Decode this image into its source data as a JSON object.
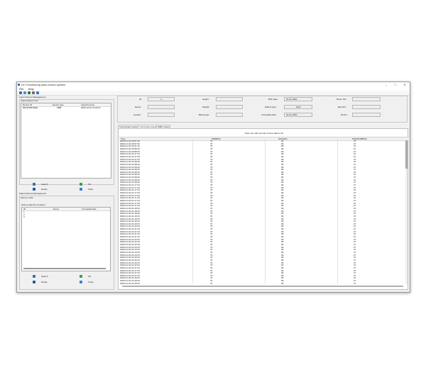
{
  "window": {
    "title": "DLT Monitoring data review system",
    "controls": {
      "minimize": "–",
      "maximize": "□",
      "close": "✕"
    }
  },
  "menu": [
    "File",
    "Help"
  ],
  "toolbar": {
    "icons": [
      "new-record-icon",
      "open-folder-icon",
      "save-icon",
      "print-icon",
      "settings-icon"
    ],
    "colors": [
      "#2d6fb5",
      "#4a90d9",
      "#2e7d32",
      "#6c6c6c",
      "#3a76c4"
    ]
  },
  "import_panel": {
    "title": "Import Record Management",
    "list_title": "Import Record List",
    "columns": [
      "Device ID",
      "Device type",
      "Importing time"
    ],
    "rows": [
      {
        "device_id": "8602345678901",
        "device_type": "M6B",
        "time": "2022-12-21 11:00:47"
      }
    ],
    "buttons": {
      "search": "Search",
      "fill": "Fill",
      "delete": "Delete",
      "clear": "Clear"
    }
  },
  "patient_panel": {
    "title": "Patient Record Management",
    "mode": "History mode",
    "list_title": "History data list of patient",
    "columns": [
      "ID",
      "Name",
      "In-hospital date"
    ],
    "rows": [
      "1",
      "2",
      "3"
    ],
    "buttons": {
      "search": "Search",
      "fill": "Fill",
      "delete": "Delete",
      "clear": "Close"
    }
  },
  "patient_info": {
    "id_label": "ID:",
    "id_value": "1",
    "name_label": "Name:",
    "gender_label": "Gender:",
    "height_label": "Height:",
    "weight_label": "Weight:",
    "blood_label": "Blood type:",
    "birth_label": "Birth date:",
    "birth_value": "01-01-2000",
    "type_label": "Patient type:",
    "type_value": "Adult",
    "inhospital_label": "In-hospital date:",
    "inhospital_value": "01-01-2000",
    "room_label": "Room NO.:",
    "bed_label": "Bed NO.:",
    "doctor_label": "Doctor:"
  },
  "tabs": [
    "Trend graph review",
    "Trend data review",
    "NIBP review"
  ],
  "trend": {
    "summary": "There are 102 records of trend data in all",
    "columns": [
      "Time",
      "PR(BPM)",
      "SPO2(%)",
      "PR(SPO2BPM)"
    ],
    "rows": [
      [
        "2000-01-02 00:57:29",
        "76",
        "99",
        "27"
      ],
      [
        "2000-01-02 00:57:30",
        "76",
        "99",
        "27"
      ],
      [
        "2000-01-02 00:57:32",
        "76",
        "99",
        "27"
      ],
      [
        "2000-01-02 00:58:33",
        "76",
        "99",
        "27"
      ],
      [
        "2000-01-02 00:58:33",
        "76",
        "99",
        "27"
      ],
      [
        "2000-01-02 01:07:33",
        "76",
        "99",
        "27"
      ],
      [
        "2000-01-02 01:07:33",
        "76",
        "99",
        "27"
      ],
      [
        "2000-01-02 01:07:33",
        "76",
        "99",
        "27"
      ],
      [
        "2000-01-02 01:08:32",
        "76",
        "99",
        "27"
      ],
      [
        "2000-01-02 01:08:32",
        "76",
        "99",
        "27"
      ],
      [
        "2000-01-02 01:08:32",
        "76",
        "99",
        "27"
      ],
      [
        "2000-01-02 01:08:32",
        "76",
        "99",
        "27"
      ],
      [
        "2000-01-02 01:08:32",
        "76",
        "99",
        "27"
      ],
      [
        "2000-01-02 01:08:32",
        "76",
        "99",
        "27"
      ],
      [
        "2000-01-02 01:08:32",
        "76",
        "99",
        "27"
      ],
      [
        "2000-01-02 01:08:32",
        "76",
        "99",
        "27"
      ],
      [
        "2000-01-02 01:08:33",
        "76",
        "99",
        "27"
      ],
      [
        "2000-01-02 01:17:33",
        "76",
        "99",
        "27"
      ],
      [
        "2000-01-02 01:17:33",
        "76",
        "99",
        "27"
      ],
      [
        "2000-01-02 01:17:33",
        "76",
        "99",
        "27"
      ],
      [
        "2000-01-02 01:17:33",
        "76",
        "99",
        "27"
      ],
      [
        "2000-01-02 01:17:33",
        "76",
        "99",
        "27"
      ],
      [
        "2000-01-02 01:17:33",
        "76",
        "99",
        "27"
      ],
      [
        "2000-01-02 01:17:33",
        "76",
        "99",
        "27"
      ],
      [
        "2000-01-02 01:17:33",
        "76",
        "99",
        "27"
      ],
      [
        "2000-01-02 01:17:33",
        "76",
        "99",
        "27"
      ],
      [
        "2000-01-02 01:18:33",
        "76",
        "99",
        "27"
      ],
      [
        "2000-01-02 01:18:33",
        "76",
        "99",
        "27"
      ],
      [
        "2000-01-02 01:18:33",
        "76",
        "99",
        "27"
      ],
      [
        "2000-01-02 01:19:33",
        "76",
        "99",
        "27"
      ],
      [
        "2000-01-02 01:19:33",
        "76",
        "99",
        "27"
      ],
      [
        "2000-01-02 01:20:33",
        "76",
        "99",
        "27"
      ],
      [
        "2000-01-02 01:20:33",
        "76",
        "99",
        "27"
      ],
      [
        "2000-01-02 01:20:33",
        "76",
        "99",
        "27"
      ],
      [
        "2000-01-02 01:21:33",
        "76",
        "99",
        "27"
      ],
      [
        "2000-01-02 01:21:33",
        "76",
        "99",
        "27"
      ],
      [
        "2000-01-02 01:21:33",
        "76",
        "99",
        "27"
      ],
      [
        "2000-01-02 01:21:33",
        "76",
        "99",
        "27"
      ],
      [
        "2000-01-02 01:22:33",
        "76",
        "99",
        "27"
      ],
      [
        "2000-01-02 01:22:33",
        "76",
        "99",
        "27"
      ],
      [
        "2000-01-02 01:22:33",
        "76",
        "99",
        "27"
      ],
      [
        "2000-01-02 01:23:33",
        "76",
        "99",
        "27"
      ],
      [
        "2000-01-02 01:23:33",
        "76",
        "99",
        "27"
      ],
      [
        "2000-01-02 01:24:33",
        "76",
        "99",
        "27"
      ],
      [
        "2000-01-02 01:24:33",
        "76",
        "99",
        "27"
      ],
      [
        "2000-01-02 01:25:33",
        "76",
        "99",
        "27"
      ],
      [
        "2000-01-02 01:25:33",
        "76",
        "99",
        "27"
      ],
      [
        "2000-01-02 01:26:33",
        "76",
        "99",
        "27"
      ],
      [
        "2000-01-02 01:26:33",
        "76",
        "99",
        "27"
      ],
      [
        "2000-01-02 01:27:33",
        "76",
        "99",
        "27"
      ],
      [
        "2000-01-02 01:27:33",
        "76",
        "99",
        "27"
      ],
      [
        "2000-01-02 01:27:33",
        "76",
        "99",
        "27"
      ],
      [
        "2000-01-02 01:27:33",
        "76",
        "99",
        "27"
      ],
      [
        "2000-01-02 01:28:33",
        "76",
        "99",
        "27"
      ],
      [
        "2000-01-02 01:28:33",
        "76",
        "99",
        "27"
      ],
      [
        "2000-01-02 01:28:33",
        "76",
        "99",
        "27"
      ]
    ]
  }
}
